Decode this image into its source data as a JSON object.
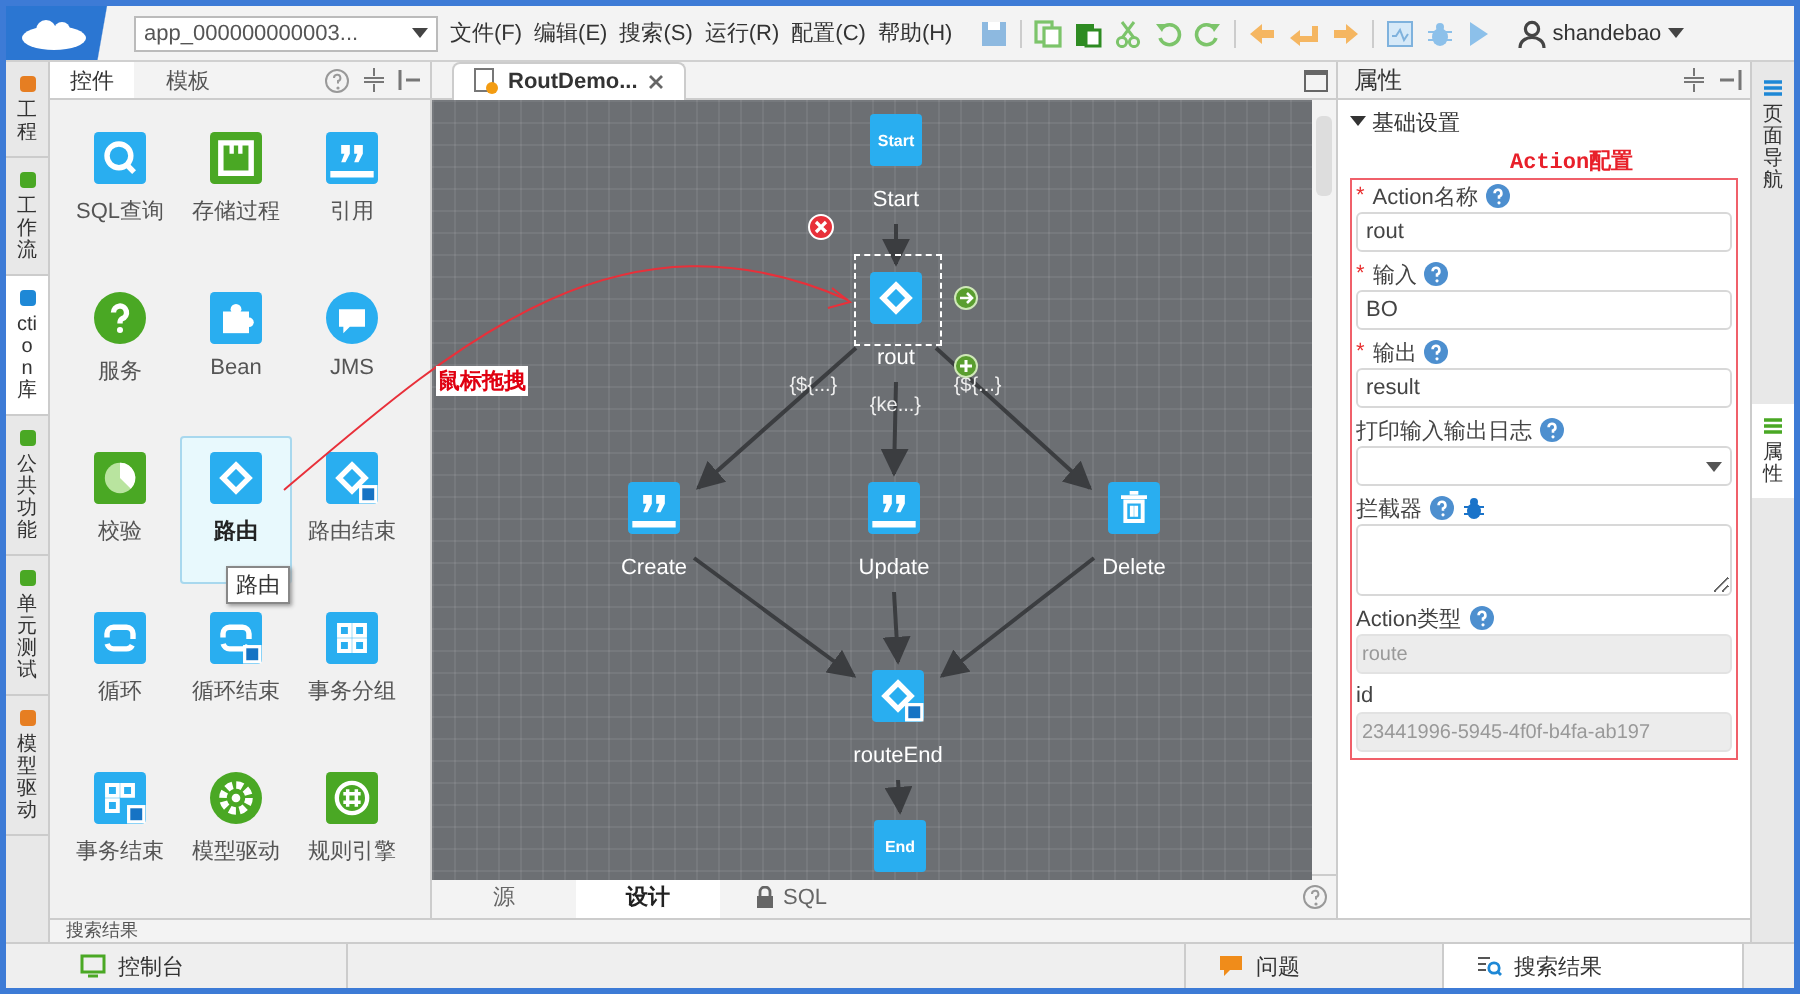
{
  "app_selector": {
    "value": "app_000000000003..."
  },
  "menu": [
    "文件(F)",
    "编辑(E)",
    "搜索(S)",
    "运行(R)",
    "配置(C)",
    "帮助(H)"
  ],
  "user": "shandebao",
  "left_tabs": [
    {
      "label": "工程",
      "selected": false
    },
    {
      "label": "工作流",
      "selected": false
    },
    {
      "label": "ction库",
      "selected": true
    },
    {
      "label": "公共功能",
      "selected": false
    },
    {
      "label": "单元测试",
      "selected": false
    },
    {
      "label": "模型驱动",
      "selected": false
    }
  ],
  "palette": {
    "tabs": [
      {
        "label": "控件",
        "selected": true
      },
      {
        "label": "模板",
        "selected": false
      }
    ],
    "tooltip": "路由",
    "items": [
      {
        "label": "SQL查询",
        "kind": "sql",
        "color": "#29aef0",
        "selected": false
      },
      {
        "label": "存储过程",
        "kind": "proc",
        "color": "#4aa824",
        "selected": false
      },
      {
        "label": "引用",
        "kind": "quote",
        "color": "#29aef0",
        "selected": false
      },
      {
        "label": "服务",
        "kind": "service",
        "color": "#4aa824",
        "selected": false
      },
      {
        "label": "Bean",
        "kind": "bean",
        "color": "#29aef0",
        "selected": false
      },
      {
        "label": "JMS",
        "kind": "jms",
        "color": "#29aef0",
        "selected": false
      },
      {
        "label": "校验",
        "kind": "check",
        "color": "#4aa824",
        "selected": false
      },
      {
        "label": "路由",
        "kind": "route",
        "color": "#29aef0",
        "selected": true
      },
      {
        "label": "路由结束",
        "kind": "route_end",
        "color": "#29aef0",
        "selected": false
      },
      {
        "label": "循环",
        "kind": "loop",
        "color": "#29aef0",
        "selected": false
      },
      {
        "label": "循环结束",
        "kind": "loop_end",
        "color": "#29aef0",
        "selected": false
      },
      {
        "label": "事务分组",
        "kind": "group",
        "color": "#29aef0",
        "selected": false
      },
      {
        "label": "事务结束",
        "kind": "group_end",
        "color": "#29aef0",
        "selected": false
      },
      {
        "label": "模型驱动",
        "kind": "model",
        "color": "#4aa824",
        "selected": false
      },
      {
        "label": "规则引擎",
        "kind": "rule",
        "color": "#4aa824",
        "selected": false
      }
    ]
  },
  "editor": {
    "tab": "RoutDemo...",
    "nodes": [
      {
        "kind": "start",
        "icon_text": "Start",
        "label": "Start",
        "selected": false
      },
      {
        "kind": "route",
        "label": "rout",
        "selected": true
      },
      {
        "kind": "quote",
        "label": "Create",
        "selected": false
      },
      {
        "kind": "quote",
        "label": "Update",
        "selected": false
      },
      {
        "kind": "delete",
        "label": "Delete",
        "selected": false
      },
      {
        "kind": "route_end",
        "label": "routeEnd",
        "selected": false
      },
      {
        "kind": "end",
        "icon_text": "End",
        "selected": false
      }
    ],
    "condition_labels": [
      "{${...}",
      "{ke...}",
      "{${...}"
    ],
    "bottom_tabs": [
      {
        "label": "源",
        "selected": false,
        "locked": false
      },
      {
        "label": "设计",
        "selected": true,
        "locked": false
      },
      {
        "label": "SQL",
        "selected": false,
        "locked": true
      }
    ]
  },
  "annotations": {
    "drag_label": "鼠标拖拽",
    "config_label": "Action配置"
  },
  "properties": {
    "title": "属性",
    "section": "基础设置",
    "expanded": true,
    "fields": [
      {
        "label": "Action名称",
        "required_mark": "*",
        "help": true,
        "kind": "text",
        "value": "rout",
        "disabled": false
      },
      {
        "label": "输入",
        "required_mark": "*",
        "help": true,
        "kind": "text",
        "value": "BO",
        "disabled": false
      },
      {
        "label": "输出",
        "required_mark": "*",
        "help": true,
        "kind": "text",
        "value": "result",
        "disabled": false
      },
      {
        "label": "打印输入输出日志",
        "help": true,
        "kind": "select"
      },
      {
        "label": "拦截器",
        "help": true,
        "debug": true,
        "kind": "textarea"
      },
      {
        "label": "Action类型",
        "help": true,
        "kind": "text",
        "value": "route",
        "disabled": true
      },
      {
        "label": "id",
        "help": false,
        "kind": "text",
        "value": "23441996-5945-4f0f-b4fa-ab197",
        "disabled": true
      }
    ]
  },
  "search_panel": {
    "title": "搜索结果"
  },
  "right_tabs": [
    {
      "label": "页面导航",
      "selected": false
    },
    {
      "label": "属性",
      "selected": true
    }
  ],
  "status_bar": [
    {
      "label": "控制台",
      "selected": false,
      "kind": "console"
    },
    {
      "label": "问题",
      "selected": false,
      "kind": "problems"
    },
    {
      "label": "搜索结果",
      "selected": true,
      "kind": "search"
    }
  ]
}
